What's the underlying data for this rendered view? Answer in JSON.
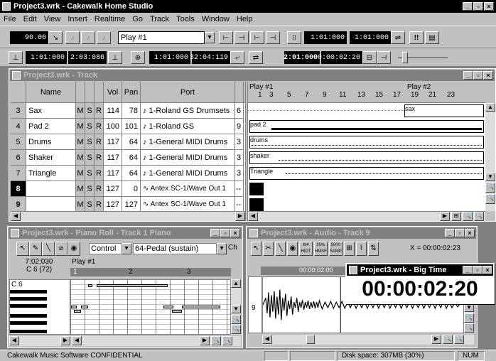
{
  "app": {
    "title": "Project3.wrk  - Cakewalk Home Studio"
  },
  "menu": [
    "File",
    "Edit",
    "View",
    "Insert",
    "Realtime",
    "Go",
    "Track",
    "Tools",
    "Window",
    "Help"
  ],
  "toolbar": {
    "tempo": "90.00",
    "play_range": "Play #1",
    "from_time": "1:01:000",
    "thru_time": "1:01:000"
  },
  "toolbar2": {
    "loop_start": "1:01:000",
    "loop_end": "2:03:086",
    "punch_start": "1:01:000",
    "punch_end": "32:04:119",
    "now_time": "2:01:000",
    "now_smpte": "00:00:02:20"
  },
  "track_window": {
    "title": "Project3.wrk - Track",
    "headers": {
      "name": "Name",
      "vol": "Vol",
      "pan": "Pan",
      "port": "Port"
    },
    "rows": [
      {
        "num": "3",
        "name": "Sax",
        "m": "M",
        "s": "S",
        "r": "R",
        "vol": "114",
        "pan": "78",
        "port": "♪ 1-Roland GS Drumsets",
        "extra": "6"
      },
      {
        "num": "4",
        "name": "Pad 2",
        "m": "M",
        "s": "S",
        "r": "R",
        "vol": "100",
        "pan": "101",
        "port": "♪ 1-Roland GS",
        "extra": "9"
      },
      {
        "num": "5",
        "name": "Drums",
        "m": "M",
        "s": "S",
        "r": "R",
        "vol": "117",
        "pan": "64",
        "port": "♪ 1-General MIDI Drums",
        "extra": "3"
      },
      {
        "num": "6",
        "name": "Shaker",
        "m": "M",
        "s": "S",
        "r": "R",
        "vol": "117",
        "pan": "64",
        "port": "♪ 1-General MIDI Drums",
        "extra": "3"
      },
      {
        "num": "7",
        "name": "Triangle",
        "m": "M",
        "s": "S",
        "r": "R",
        "vol": "117",
        "pan": "64",
        "port": "♪ 1-General MIDI Drums",
        "extra": "3"
      },
      {
        "num": "8",
        "name": "",
        "m": "M",
        "s": "S",
        "r": "R",
        "vol": "127",
        "pan": "0",
        "port": "∿ Antex SC-1/Wave Out 1",
        "extra": "--"
      },
      {
        "num": "9",
        "name": "",
        "m": "M",
        "s": "S",
        "r": "R",
        "vol": "127",
        "pan": "127",
        "port": "∿ Antex SC-1/Wave Out 1",
        "extra": "--"
      }
    ],
    "markers": {
      "m1": "Play #1",
      "m2": "Play #2"
    },
    "ruler": [
      "1",
      "3",
      "5",
      "7",
      "9",
      "11",
      "13",
      "15",
      "17",
      "19",
      "21",
      "23"
    ],
    "clips": [
      "sax",
      "pad 2",
      "drums",
      "shaker",
      "Triangle"
    ]
  },
  "piano_roll": {
    "title": "Project3.wrk - Piano Roll - Track 1 Piano",
    "control": "Control",
    "controller": "64-Pedal (sustain)",
    "ch": "Ch",
    "time": "7:02:030",
    "pitch": "C 6 (72)",
    "marker": "Play #1",
    "ruler": [
      "1",
      "2",
      "3"
    ],
    "note_label": "C 6"
  },
  "audio": {
    "title": "Project3.wrk - Audio - Track 9",
    "time_readout": "X = 00:00:02:23",
    "ruler_time": "00:00:02:00",
    "track_num": "9",
    "btn1": "8/4 HIDT",
    "btn2": "35% HMSF",
    "btn3": "5000 SAMP"
  },
  "big_time": {
    "title": "Project3.wrk - Big Time",
    "time": "00:00:02:20"
  },
  "status": {
    "left": "Cakewalk Music Software CONFIDENTIAL",
    "disk": "Disk space: 307MB (30%)",
    "num": "NUM"
  }
}
